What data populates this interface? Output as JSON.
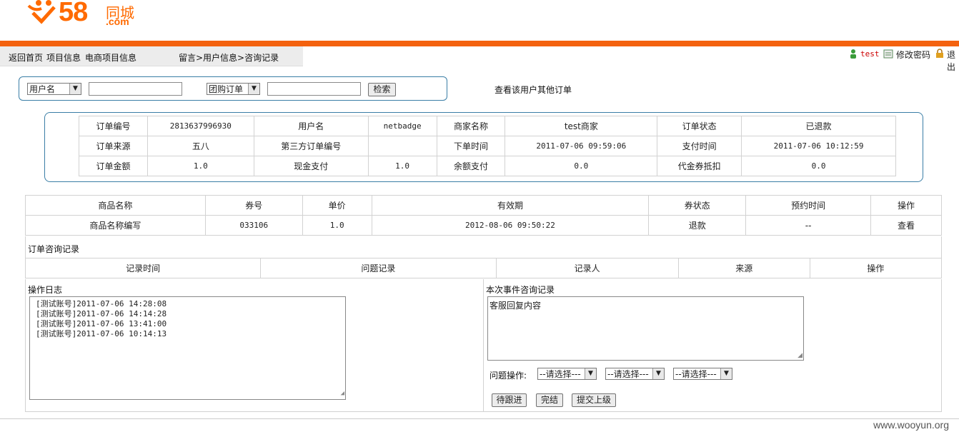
{
  "header": {
    "logo_number": "58",
    "logo_cn": "同城",
    "logo_com": ".com",
    "accent_color": "#f4620f"
  },
  "nav": {
    "items": [
      "返回首页",
      "项目信息",
      "电商项目信息"
    ],
    "breadcrumb": "留言>用户信息>咨询记录",
    "user": "test",
    "change_password": "修改密码",
    "logout": "退出"
  },
  "search": {
    "field_select": "用户名",
    "order_type_select": "团购订单",
    "field_value": "",
    "order_value": "",
    "search_button": "检索",
    "other_orders_link": "查看该用户其他订单"
  },
  "order_info": {
    "rows": [
      [
        "订单编号",
        "2813637996930",
        "用户名",
        "netbadge",
        "商家名称",
        "test商家",
        "订单状态",
        "已退款"
      ],
      [
        "订单来源",
        "五八",
        "第三方订单编号",
        "",
        "下单时间",
        "2011-07-06 09:59:06",
        "支付时间",
        "2011-07-06 10:12:59"
      ],
      [
        "订单金额",
        "1.0",
        "现金支付",
        "1.0",
        "余额支付",
        "0.0",
        "代金券抵扣",
        "0.0"
      ]
    ]
  },
  "products": {
    "headers": [
      "商品名称",
      "券号",
      "单价",
      "有效期",
      "券状态",
      "预约时间",
      "操作"
    ],
    "rows": [
      [
        "商品名称编写",
        "033106",
        "1.0",
        "2012-08-06 09:50:22",
        "退款",
        "--",
        "查看"
      ]
    ]
  },
  "consult": {
    "title": "订单咨询记录",
    "headers": [
      "记录时间",
      "问题记录",
      "记录人",
      "来源",
      "操作"
    ]
  },
  "log": {
    "title": "操作日志",
    "entries": [
      "[测试账号]2011-07-06 14:28:08",
      "[测试账号]2011-07-06 14:14:28",
      "[测试账号]2011-07-06 13:41:00",
      "[测试账号]2011-07-06 10:14:13"
    ]
  },
  "event": {
    "title": "本次事件咨询记录",
    "reply_text": "客服回复内容",
    "problem_label": "问题操作:",
    "select_placeholder": "--请选择---",
    "buttons": [
      "待跟进",
      "完结",
      "提交上级"
    ]
  },
  "watermark": "www.wooyun.org"
}
